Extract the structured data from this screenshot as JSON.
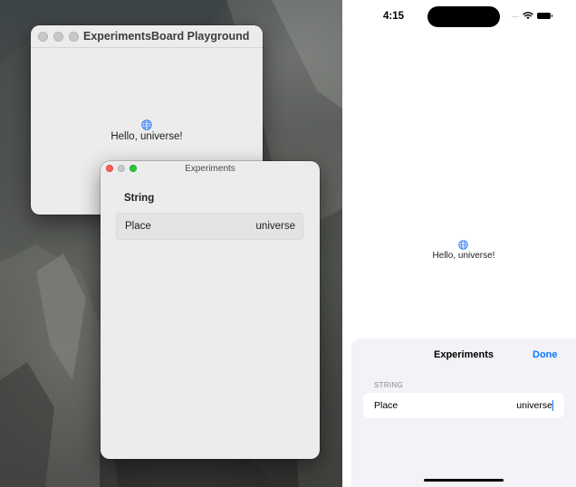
{
  "desktop": {
    "playground_window": {
      "title": "ExperimentsBoard Playground",
      "globe_icon": "globe-icon",
      "greeting": "Hello, universe!"
    },
    "experiments_window": {
      "title": "Experiments",
      "section_label": "String",
      "row": {
        "label": "Place",
        "value": "universe"
      }
    }
  },
  "phone": {
    "status_bar": {
      "time": "4:15",
      "signal": "....",
      "icons": [
        "wifi-icon",
        "battery-icon"
      ]
    },
    "globe_icon": "globe-icon",
    "greeting": "Hello, universe!",
    "sheet": {
      "title": "Experiments",
      "done_label": "Done",
      "section_label": "STRING",
      "row": {
        "label": "Place",
        "value": "universe"
      }
    }
  },
  "colors": {
    "accent_blue": "#0a7aff",
    "globe_blue": "#3b82f6",
    "traffic_red": "#ff5f57",
    "traffic_green": "#28c840",
    "window_bg": "#ececec",
    "sheet_bg": "#f2f2f7"
  }
}
